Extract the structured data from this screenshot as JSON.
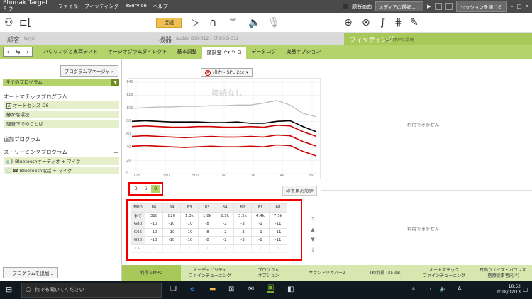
{
  "window": {
    "title": "Phonak Target 5.2",
    "menu": [
      "ファイル",
      "フィッティング",
      "eService",
      "ヘルプ"
    ],
    "client_screen": "顧客画面",
    "media_select": "メディアの選択...",
    "close_session": "セッションを閉じる"
  },
  "toolbar": {
    "connect": "接続"
  },
  "section": {
    "client": "顧客",
    "client_name": "twyri",
    "device": "機器",
    "device_name": "Audéo B30-312 / CROS B-312",
    "fitting": "フィッティング",
    "fitting_program": "(2) 静かな環境"
  },
  "tabs": [
    "ハウリングと実耳テスト",
    "オージオグラムダイレクト",
    "基本調整",
    "微調整",
    "データログ",
    "機器オプション"
  ],
  "left": {
    "program_manager": "プログラムマネージャ",
    "all_programs": "全てのプログラム",
    "auto_group": "オートマチックプログラム",
    "auto_items": [
      "オートセンス OS",
      "静かな環境",
      "騒音下でのことば"
    ],
    "add_group": "追加プログラム",
    "streaming_group": "ストリーミングプログラム",
    "streaming_items": [
      "Bluetoothオーディオ + マイク",
      "Bluetooth電話 + マイク"
    ],
    "add_program": "+ プログラムを追加..."
  },
  "center": {
    "output_select": "出力 - SPL 2cc",
    "not_connected": "接続なし",
    "unavailable": "利用できません",
    "test_settings": "検査用の設定",
    "gain_steps": [
      "3",
      "6",
      "8"
    ]
  },
  "chart_data": {
    "type": "line",
    "title": "",
    "ylim": [
      0,
      140
    ],
    "y_ticks": [
      0,
      20,
      40,
      60,
      80,
      100,
      120,
      140
    ],
    "x_ticks": [
      "125",
      "250",
      "500",
      "1k",
      "2k",
      "4k",
      "8k"
    ],
    "watermark": "接続なし",
    "series": [
      {
        "color": "#bbbbbb",
        "values": [
          100,
          101,
          102,
          102,
          103,
          103,
          104,
          104,
          105,
          105,
          108,
          112,
          105,
          92,
          87
        ]
      },
      {
        "color": "#000000",
        "values": [
          80,
          81,
          80,
          79,
          79,
          79,
          78,
          78,
          79,
          77,
          77,
          80,
          81,
          72,
          64
        ]
      },
      {
        "color": "#cc0000",
        "values": [
          72,
          73,
          72,
          71,
          71,
          72,
          72,
          71,
          71,
          72,
          71,
          74,
          73,
          64,
          57
        ]
      },
      {
        "color": "#cc0000",
        "values": [
          57,
          58,
          57,
          56,
          55,
          56,
          57,
          56,
          56,
          57,
          56,
          59,
          58,
          49,
          42
        ]
      },
      {
        "color": "#cc0000",
        "values": [
          42,
          43,
          42,
          41,
          40,
          41,
          42,
          41,
          41,
          42,
          41,
          44,
          43,
          34,
          27
        ]
      }
    ]
  },
  "table": {
    "header": [
      "MPO",
      "86",
      "84",
      "83",
      "83",
      "84",
      "82",
      "81",
      "68"
    ],
    "rows": [
      [
        "全て",
        "310",
        "820",
        "1.3k",
        "1.8k",
        "2.5k",
        "3.2k",
        "4.4k",
        "7.5k"
      ],
      [
        "G80",
        "-10",
        "-10",
        "-10",
        "-8",
        "-2",
        "-3",
        "-1",
        "-11"
      ],
      [
        "G65",
        "-10",
        "-10",
        "-10",
        "-8",
        "-2",
        "-3",
        "-1",
        "-11"
      ],
      [
        "G50",
        "-10",
        "-10",
        "-10",
        "-8",
        "-2",
        "-3",
        "-1",
        "-11"
      ],
      [
        "CR",
        "1",
        "1",
        "1",
        "1",
        "1",
        "1",
        "1",
        "1"
      ]
    ]
  },
  "bottom_tabs": [
    "利得＆MPO",
    "オーディビリティ\nファインチューニング",
    "プログラム\nオプション",
    "サウンドリカバー2",
    "TK/利得 (35 dB)",
    "オートマチック\nファインチューニング",
    "耳鳴りノイズ・バランス\n(医療従事者向け)"
  ],
  "taskbar": {
    "search": "何でも聞いてください",
    "time": "10:52",
    "date": "2018/02/13",
    "ime": "A"
  }
}
